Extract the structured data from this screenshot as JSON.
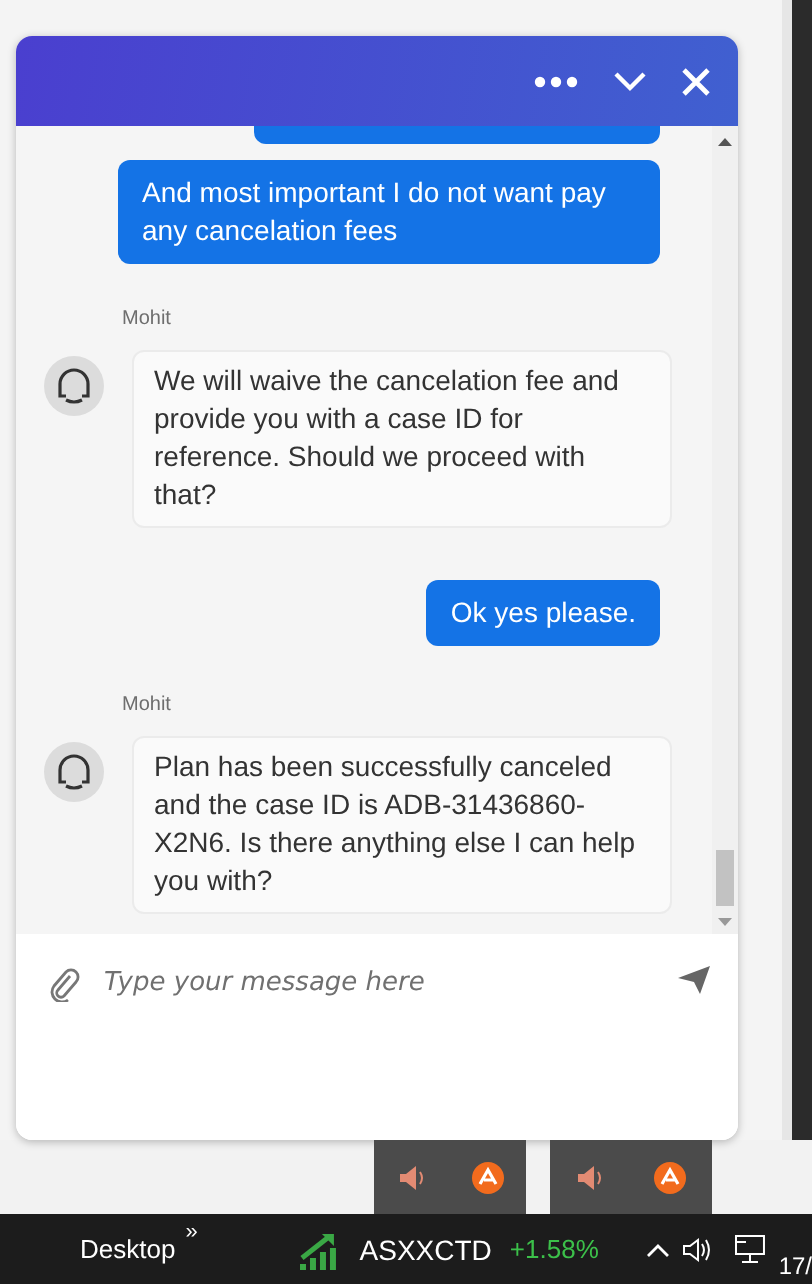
{
  "chat": {
    "messages": [
      {
        "kind": "clipped"
      },
      {
        "kind": "user",
        "text": "And most important I do not want pay any cancelation fees"
      },
      {
        "kind": "agent",
        "author": "Mohit",
        "text": "We will waive the cancelation fee and provide you with a case ID for reference. Should we proceed with that?"
      },
      {
        "kind": "user",
        "text": "Ok yes please."
      },
      {
        "kind": "agent",
        "author": "Mohit",
        "text": "Plan has been successfully canceled and the case ID is ADB-31436860-X2N6. Is there anything else I can help you with?"
      }
    ],
    "composer": {
      "placeholder": "Type your message here"
    }
  },
  "taskbar": {
    "desktop": "Desktop",
    "chevron": "»",
    "ticker": {
      "symbol": "ASXXCTD",
      "change": "+1.58%"
    },
    "clock": "17/"
  }
}
